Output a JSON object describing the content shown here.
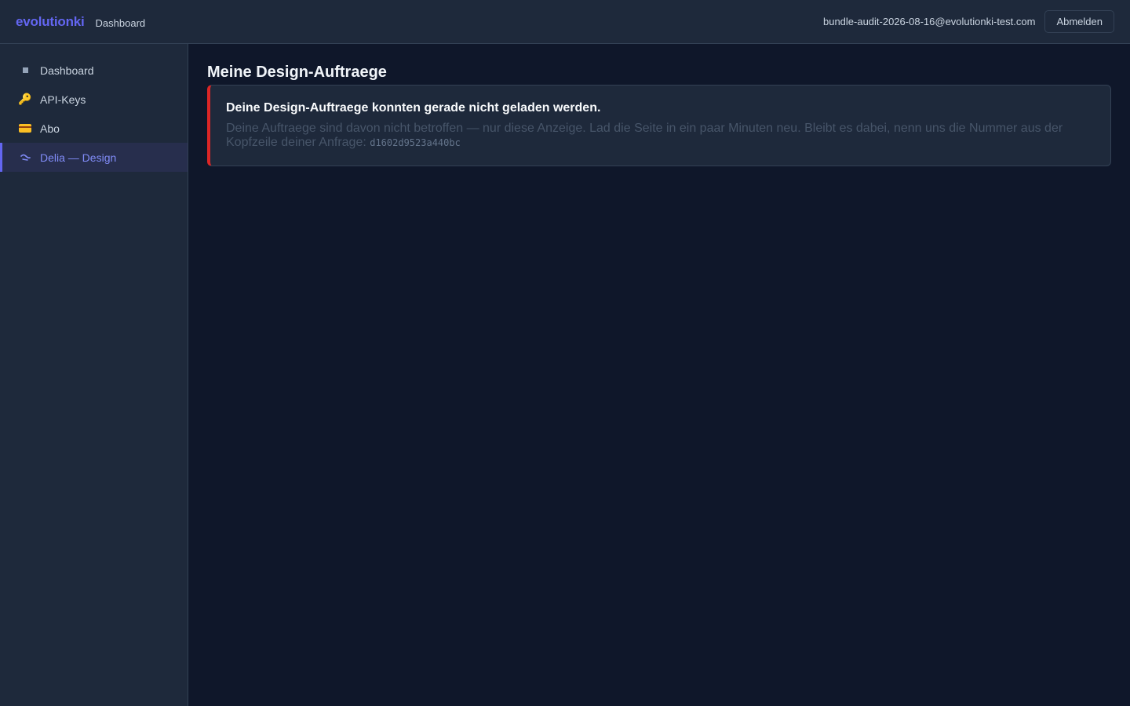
{
  "header": {
    "brand": "evolutionki",
    "subtitle": "Dashboard",
    "user_email": "bundle-audit-2026-08-16@evolutionki-test.com",
    "logout_label": "Abmelden"
  },
  "sidebar": {
    "items": [
      {
        "label": "Dashboard",
        "icon": "square-icon",
        "active": false
      },
      {
        "label": "API-Keys",
        "icon": "key-icon",
        "active": false
      },
      {
        "label": "Abo",
        "icon": "credit-card-icon",
        "active": false
      },
      {
        "label": "Delia — Design",
        "icon": "brush-icon",
        "active": true
      }
    ]
  },
  "main": {
    "title": "Meine Design-Auftraege",
    "error": {
      "title": "Deine Design-Auftraege konnten gerade nicht geladen werden.",
      "message": "Deine Auftraege sind davon nicht betroffen — nur diese Anzeige. Lad die Seite in ein paar Minuten neu. Bleibt es dabei, nenn uns die Nummer aus der Kopfzeile deiner Anfrage: ",
      "request_id": "d1602d9523a440bc"
    }
  },
  "colors": {
    "accent": "#6366f1",
    "error": "#dc2626",
    "background": "#0f172a",
    "panel": "#1e293b"
  }
}
